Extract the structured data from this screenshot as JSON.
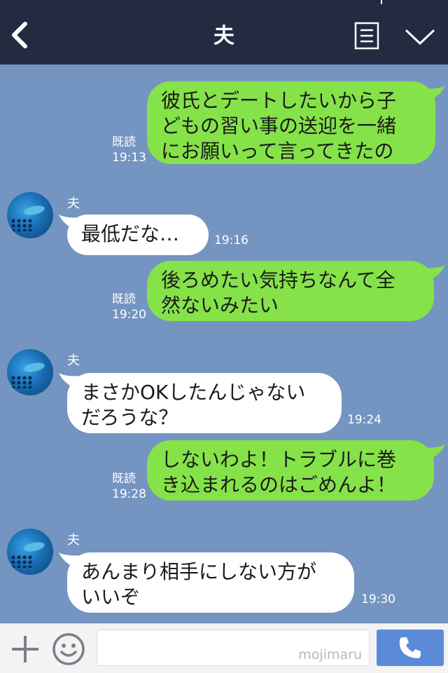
{
  "header": {
    "title": "夫",
    "back_icon": "chevron-left-icon",
    "menu_icon": "menu-list-icon",
    "collapse_icon": "chevron-down-icon"
  },
  "messages": [
    {
      "direction": "out",
      "lines": [
        "彼氏とデートしたいから子",
        "どもの習い事の送迎を一緒",
        "にお願いって言ってきたの"
      ],
      "read": "既読",
      "time": "19:13"
    },
    {
      "direction": "in",
      "sender": "夫",
      "lines": [
        "最低だな…"
      ],
      "time": "19:16"
    },
    {
      "direction": "out",
      "lines": [
        "後ろめたい気持ちなんて全",
        "然ないみたい"
      ],
      "read": "既読",
      "time": "19:20"
    },
    {
      "direction": "in",
      "sender": "夫",
      "lines": [
        "まさかOKしたんじゃない",
        "だろうな？"
      ],
      "time": "19:24"
    },
    {
      "direction": "out",
      "lines": [
        "しないわよ！トラブルに巻",
        "き込まれるのはごめんよ！"
      ],
      "read": "既読",
      "time": "19:28"
    },
    {
      "direction": "in",
      "sender": "夫",
      "lines": [
        "あんまり相手にしない方が",
        "いいぞ"
      ],
      "time": "19:30"
    }
  ],
  "footer": {
    "input_value": "",
    "watermark": "mojimaru",
    "plus_icon": "plus-icon",
    "emoji_icon": "smiley-icon",
    "call_icon": "phone-icon"
  },
  "colors": {
    "header_bg": "#232b40",
    "chat_bg": "#7494c1",
    "outgoing_bubble": "#85e249",
    "incoming_bubble": "#ffffff",
    "call_button": "#5b8bd8"
  }
}
